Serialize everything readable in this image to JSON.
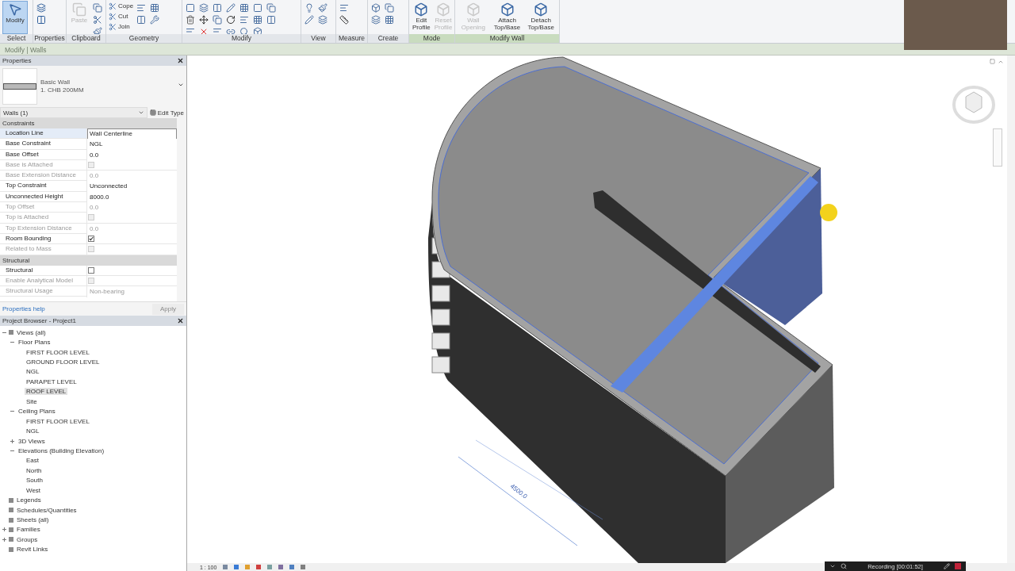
{
  "ribbon": {
    "panels": [
      {
        "label": "Select",
        "kind": "large",
        "tools": [
          {
            "label": "Modify",
            "selected": true,
            "disabled": false
          }
        ]
      },
      {
        "label": "Properties",
        "kind": "icons"
      },
      {
        "label": "Clipboard",
        "kind": "large",
        "tools": [
          {
            "label": "Paste",
            "selected": false,
            "disabled": true
          }
        ]
      },
      {
        "label": "Geometry",
        "kind": "small",
        "tools": [
          {
            "label": "Cope",
            "selected": false,
            "disabled": false
          },
          {
            "label": "Cut",
            "selected": false,
            "disabled": false
          },
          {
            "label": "Join",
            "selected": false,
            "disabled": false
          }
        ]
      },
      {
        "label": "Modify",
        "kind": "icons"
      },
      {
        "label": "View",
        "kind": "icons"
      },
      {
        "label": "Measure",
        "kind": "icons"
      },
      {
        "label": "Create",
        "kind": "icons"
      },
      {
        "label": "Mode",
        "kind": "large",
        "contextual": true,
        "tools": [
          {
            "label": "Edit Profile",
            "selected": false,
            "disabled": false
          },
          {
            "label": "Reset Profile",
            "selected": false,
            "disabled": true
          }
        ]
      },
      {
        "label": "Modify Wall",
        "kind": "large",
        "contextual": true,
        "tools": [
          {
            "label": "Wall Opening",
            "selected": false,
            "disabled": true
          },
          {
            "label": "Attach Top/Base",
            "selected": false,
            "disabled": false
          },
          {
            "label": "Detach Top/Base",
            "selected": false,
            "disabled": false
          }
        ]
      }
    ]
  },
  "context_bar": {
    "title": "Modify | Walls"
  },
  "properties": {
    "title": "Properties",
    "type_family": "Basic Wall",
    "type_name": "1. CHB 200MM",
    "selector": "Walls (1)",
    "edit_type": "Edit Type",
    "groups": [
      {
        "title": "Constraints",
        "rows": [
          {
            "label": "Location Line",
            "kind": "text",
            "value": "Wall Centerline",
            "disabled": false,
            "focused": true
          },
          {
            "label": "Base Constraint",
            "kind": "text",
            "value": "NGL",
            "disabled": false,
            "focused": false
          },
          {
            "label": "Base Offset",
            "kind": "text",
            "value": "0.0",
            "disabled": false,
            "focused": false
          },
          {
            "label": "Base is Attached",
            "kind": "checkbox",
            "checked": false,
            "disabled": true,
            "focused": false
          },
          {
            "label": "Base Extension Distance",
            "kind": "text",
            "value": "0.0",
            "disabled": true,
            "focused": false
          },
          {
            "label": "Top Constraint",
            "kind": "text",
            "value": "Unconnected",
            "disabled": false,
            "focused": false
          },
          {
            "label": "Unconnected Height",
            "kind": "text",
            "value": "8000.0",
            "disabled": false,
            "focused": false
          },
          {
            "label": "Top Offset",
            "kind": "text",
            "value": "0.0",
            "disabled": true,
            "focused": false
          },
          {
            "label": "Top is Attached",
            "kind": "checkbox",
            "checked": false,
            "disabled": true,
            "focused": false
          },
          {
            "label": "Top Extension Distance",
            "kind": "text",
            "value": "0.0",
            "disabled": true,
            "focused": false
          },
          {
            "label": "Room Bounding",
            "kind": "checkbox",
            "checked": true,
            "disabled": false,
            "focused": false
          },
          {
            "label": "Related to Mass",
            "kind": "checkbox",
            "checked": false,
            "disabled": true,
            "focused": false
          }
        ]
      },
      {
        "title": "Structural",
        "rows": [
          {
            "label": "Structural",
            "kind": "checkbox",
            "checked": false,
            "disabled": false,
            "focused": false
          },
          {
            "label": "Enable Analytical Model",
            "kind": "checkbox",
            "checked": false,
            "disabled": true,
            "focused": false
          },
          {
            "label": "Structural Usage",
            "kind": "text",
            "value": "Non-bearing",
            "disabled": true,
            "focused": false
          }
        ]
      }
    ],
    "help_link": "Properties help",
    "apply": {
      "label": "Apply",
      "disabled": true
    }
  },
  "project_browser": {
    "title": "Project Browser - Project1",
    "tree": [
      {
        "label": "Views (all)",
        "selected": false,
        "expanded": true,
        "children": [
          {
            "label": "Floor Plans",
            "selected": false,
            "expanded": true,
            "children": [
              {
                "label": "FIRST FLOOR LEVEL",
                "selected": false
              },
              {
                "label": "GROUND FLOOR LEVEL",
                "selected": false
              },
              {
                "label": "NGL",
                "selected": false
              },
              {
                "label": "PARAPET LEVEL",
                "selected": false
              },
              {
                "label": "ROOF LEVEL",
                "selected": true
              },
              {
                "label": "Site",
                "selected": false
              }
            ]
          },
          {
            "label": "Ceiling Plans",
            "selected": false,
            "expanded": true,
            "children": [
              {
                "label": "FIRST FLOOR LEVEL",
                "selected": false
              },
              {
                "label": "NGL",
                "selected": false
              }
            ]
          },
          {
            "label": "3D Views",
            "selected": false,
            "expanded": false
          },
          {
            "label": "Elevations (Building Elevation)",
            "selected": false,
            "expanded": true,
            "children": [
              {
                "label": "East",
                "selected": false
              },
              {
                "label": "North",
                "selected": false
              },
              {
                "label": "South",
                "selected": false
              },
              {
                "label": "West",
                "selected": false
              }
            ]
          }
        ]
      },
      {
        "label": "Legends",
        "selected": false
      },
      {
        "label": "Schedules/Quantities",
        "selected": false
      },
      {
        "label": "Sheets (all)",
        "selected": false
      },
      {
        "label": "Families",
        "selected": false,
        "expanded": false
      },
      {
        "label": "Groups",
        "selected": false,
        "expanded": false
      },
      {
        "label": "Revit Links",
        "selected": false
      }
    ]
  },
  "viewport": {
    "dimension": "4500.0"
  },
  "status_bar": {
    "scale": "1 : 100"
  },
  "recorder": {
    "status": "Recording [00:01:52]"
  }
}
